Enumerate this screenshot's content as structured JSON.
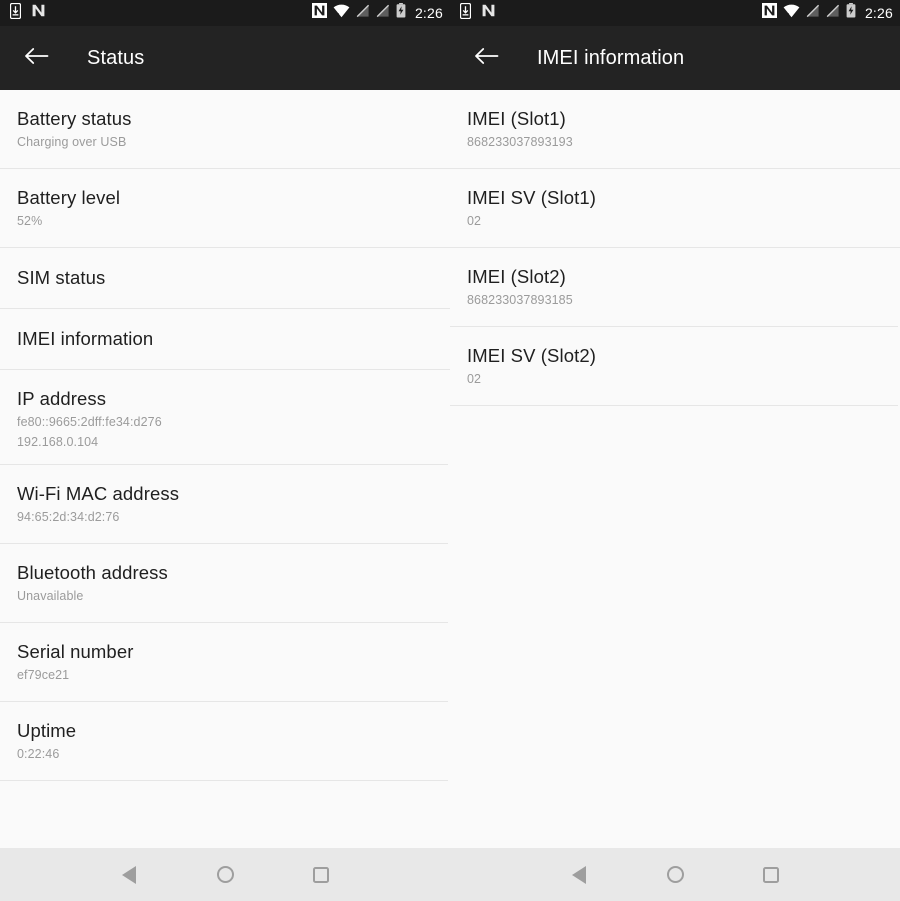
{
  "status_bar": {
    "time": "2:26",
    "left_icons": [
      "phone-download-icon",
      "nfc-n-icon"
    ],
    "right_icons": [
      "nfc-boxed-n-icon",
      "wifi-icon",
      "no-signal-slot1-icon",
      "no-signal-slot2-icon",
      "battery-charging-icon"
    ]
  },
  "colors": {
    "status_bar_bg": "#1b1b1b",
    "app_bar_bg": "#232323",
    "content_bg": "#fafafa",
    "nav_bar_bg": "#e8e8e8",
    "divider": "#e6e6e6",
    "title_text": "#1f1f1f",
    "subtitle_text": "#9b9b9b",
    "app_bar_text": "#ffffff",
    "nav_icon": "#9e9e9e"
  },
  "nav_bar": {
    "back_label": "Back",
    "home_label": "Home",
    "recents_label": "Recents"
  },
  "left_screen": {
    "title": "Status",
    "back_icon": "arrow-left-icon",
    "items": [
      {
        "title": "Battery status",
        "subtitle": "Charging over USB",
        "subtitle2": ""
      },
      {
        "title": "Battery level",
        "subtitle": "52%",
        "subtitle2": ""
      },
      {
        "title": "SIM status",
        "subtitle": "",
        "subtitle2": ""
      },
      {
        "title": "IMEI information",
        "subtitle": "",
        "subtitle2": ""
      },
      {
        "title": "IP address",
        "subtitle": "fe80::9665:2dff:fe34:d276",
        "subtitle2": "192.168.0.104"
      },
      {
        "title": "Wi-Fi MAC address",
        "subtitle": "94:65:2d:34:d2:76",
        "subtitle2": ""
      },
      {
        "title": "Bluetooth address",
        "subtitle": "Unavailable",
        "subtitle2": ""
      },
      {
        "title": "Serial number",
        "subtitle": "ef79ce21",
        "subtitle2": ""
      },
      {
        "title": "Uptime",
        "subtitle": "0:22:46",
        "subtitle2": ""
      }
    ]
  },
  "right_screen": {
    "title": "IMEI information",
    "back_icon": "arrow-left-icon",
    "items": [
      {
        "title": "IMEI (Slot1)",
        "subtitle": "868233037893193",
        "subtitle2": ""
      },
      {
        "title": "IMEI SV (Slot1)",
        "subtitle": "02",
        "subtitle2": ""
      },
      {
        "title": "IMEI (Slot2)",
        "subtitle": "868233037893185",
        "subtitle2": ""
      },
      {
        "title": "IMEI SV (Slot2)",
        "subtitle": "02",
        "subtitle2": ""
      }
    ]
  }
}
